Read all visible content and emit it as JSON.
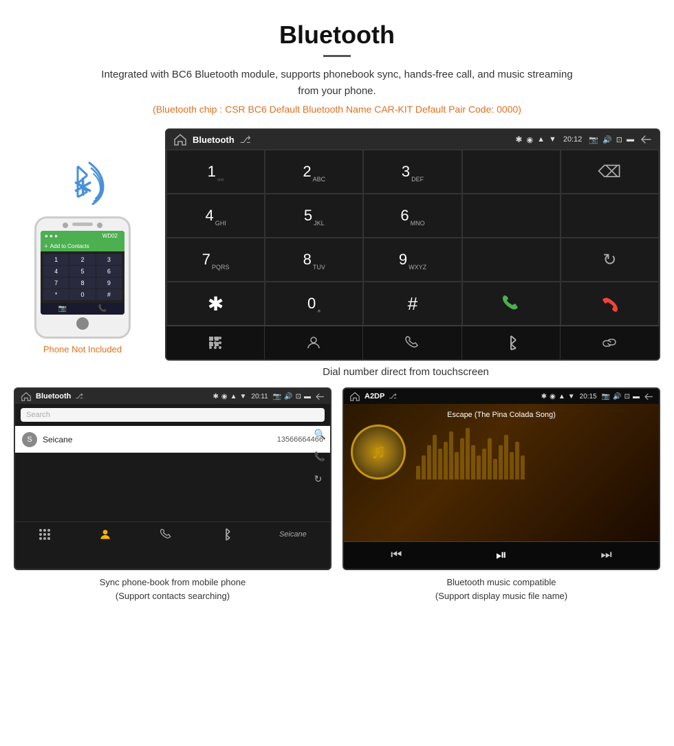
{
  "header": {
    "title": "Bluetooth",
    "description": "Integrated with BC6 Bluetooth module, supports phonebook sync, hands-free call, and music streaming from your phone.",
    "specs": "(Bluetooth chip : CSR BC6    Default Bluetooth Name CAR-KIT    Default Pair Code: 0000)"
  },
  "phone_label": "Phone Not Included",
  "dial_screen": {
    "status_bar": {
      "app_name": "Bluetooth",
      "time": "20:12"
    },
    "keys": [
      {
        "num": "1",
        "sub": ""
      },
      {
        "num": "2",
        "sub": "ABC"
      },
      {
        "num": "3",
        "sub": "DEF"
      },
      {
        "num": "",
        "sub": ""
      },
      {
        "num": "⌫",
        "sub": ""
      },
      {
        "num": "4",
        "sub": "GHI"
      },
      {
        "num": "5",
        "sub": "JKL"
      },
      {
        "num": "6",
        "sub": "MNO"
      },
      {
        "num": "",
        "sub": ""
      },
      {
        "num": "",
        "sub": ""
      },
      {
        "num": "7",
        "sub": "PQRS"
      },
      {
        "num": "8",
        "sub": "TUV"
      },
      {
        "num": "9",
        "sub": "WXYZ"
      },
      {
        "num": "",
        "sub": ""
      },
      {
        "num": "↺",
        "sub": ""
      },
      {
        "num": "*",
        "sub": ""
      },
      {
        "num": "0",
        "sub": "+"
      },
      {
        "num": "#",
        "sub": ""
      },
      {
        "num": "📞",
        "sub": ""
      },
      {
        "num": "📞red",
        "sub": ""
      }
    ]
  },
  "dial_caption": "Dial number direct from touchscreen",
  "phonebook_screen": {
    "status_bar": {
      "app_name": "Bluetooth",
      "time": "20:11"
    },
    "search_placeholder": "Search",
    "contact": {
      "initial": "S",
      "name": "Seicane",
      "phone": "13566664466"
    }
  },
  "music_screen": {
    "status_bar": {
      "app_name": "A2DP",
      "time": "20:15"
    },
    "song_title": "Escape (The Pina Colada Song)"
  },
  "bottom_captions": {
    "left": "Sync phone-book from mobile phone\n(Support contacts searching)",
    "right": "Bluetooth music compatible\n(Support display music file name)"
  },
  "viz_bars": [
    20,
    35,
    50,
    65,
    45,
    55,
    70,
    40,
    60,
    75,
    50,
    35,
    45,
    60,
    30,
    50,
    65,
    40,
    55,
    35
  ]
}
